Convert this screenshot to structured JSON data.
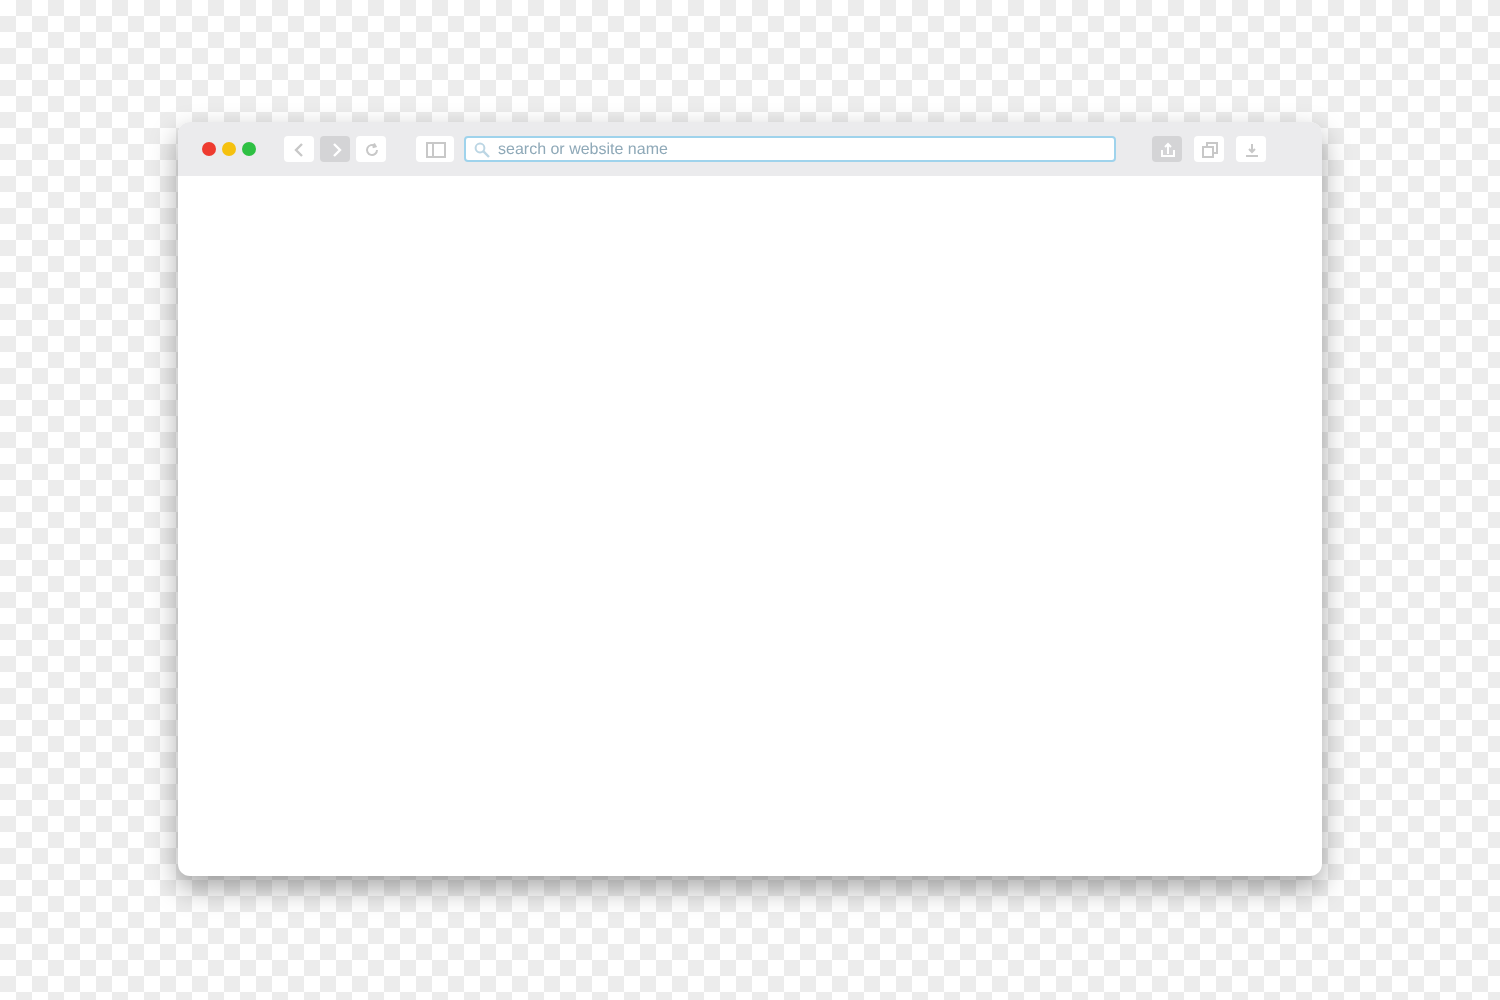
{
  "toolbar": {
    "traffic_lights": [
      {
        "color": "#ee3b30"
      },
      {
        "color": "#f5c10f"
      },
      {
        "color": "#2ec043"
      }
    ],
    "nav_buttons": [
      {
        "kind": "back",
        "disabled": false
      },
      {
        "kind": "forward",
        "disabled": true
      },
      {
        "kind": "reload",
        "disabled": false
      },
      {
        "kind": "sidebar",
        "disabled": false
      }
    ],
    "address_bar": {
      "placeholder": "search or website name"
    },
    "action_buttons": [
      {
        "kind": "share",
        "disabled": true
      },
      {
        "kind": "tabs",
        "disabled": false
      },
      {
        "kind": "download",
        "disabled": false
      }
    ]
  }
}
